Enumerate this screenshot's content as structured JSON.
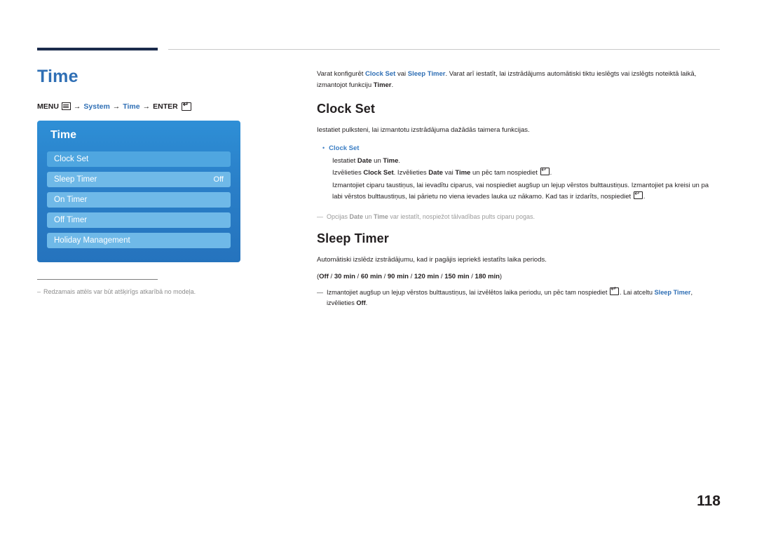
{
  "document": {
    "page_number": "118",
    "title": "Time"
  },
  "menu_path": {
    "menu_label": "MENU",
    "menu_icon": "menu-icon",
    "arrow": "→",
    "item1": "System",
    "item2": "Time",
    "enter_label": "ENTER",
    "enter_icon": "enter-icon"
  },
  "osd": {
    "title": "Time",
    "rows": [
      {
        "label": "Clock Set",
        "value": "",
        "selected": false
      },
      {
        "label": "Sleep Timer",
        "value": "Off",
        "selected": true
      },
      {
        "label": "On Timer",
        "value": "",
        "selected": true
      },
      {
        "label": "Off Timer",
        "value": "",
        "selected": true
      },
      {
        "label": "Holiday Management",
        "value": "",
        "selected": true
      }
    ]
  },
  "left_footnote": {
    "dash": "–",
    "text": "Redzamais attēls var būt atšķirīgs atkarībā no modeļa."
  },
  "intro": {
    "p1_a": "Varat konfigurēt ",
    "p1_b1": "Clock Set",
    "p1_c": " vai ",
    "p1_b2": "Sleep Timer",
    "p1_d": ". Varat arī iestatīt, lai izstrādājums automātiski tiktu ieslēgts vai izslēgts noteiktā laikā, izmantojot funkciju ",
    "p1_b3": "Timer",
    "p1_e": "."
  },
  "clock_set": {
    "heading": "Clock Set",
    "p1": "Iestatiet pulksteni, lai izmantotu izstrādājuma dažādās taimera funkcijas.",
    "bullet_label": "Clock Set",
    "line1_a": "Iestatiet ",
    "line1_b1": "Date",
    "line1_b": " un ",
    "line1_b2": "Time",
    "line1_c": ".",
    "line2_a": "Izvēlieties ",
    "line2_b1": "Clock Set",
    "line2_b": ". Izvēlieties ",
    "line2_b2": "Date",
    "line2_c": " vai ",
    "line2_b3": "Time",
    "line2_d": " un pēc tam nospiediet ",
    "line2_e": ".",
    "line3": "Izmantojiet ciparu taustiņus, lai ievadītu ciparus, vai nospiediet augšup un lejup vērstos bulttaustiņus. Izmantojiet pa kreisi un pa labi vērstos bulttaustiņus, lai pārietu no viena ievades lauka uz nākamo. Kad tas ir izdarīts, nospiediet ",
    "line3_end": ".",
    "note_dash": "―",
    "note_a": "Opcijas ",
    "note_b1": "Date",
    "note_b": " un ",
    "note_b2": "Time",
    "note_c": " var iestatīt, nospiežot tālvadības pults ciparu pogas."
  },
  "sleep_timer": {
    "heading": "Sleep Timer",
    "p1": "Automātiski izslēdz izstrādājumu, kad ir pagājis iepriekš iestatīts laika periods.",
    "options_open": "(",
    "options": [
      "Off",
      "30 min",
      "60 min",
      "90 min",
      "120 min",
      "150 min",
      "180 min"
    ],
    "options_close": ")",
    "note_dash": "―",
    "note_a": "Izmantojiet augšup un lejup vērstos bulttaustiņus, lai izvēlētos laika periodu, un pēc tam nospiediet ",
    "note_b": ". Lai atceltu ",
    "note_b1": "Sleep Timer",
    "note_c": ", izvēlieties ",
    "note_b2": "Off",
    "note_d": "."
  }
}
